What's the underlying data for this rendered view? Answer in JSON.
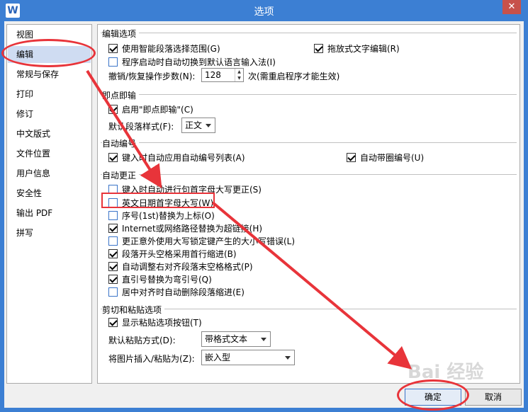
{
  "window": {
    "title": "选项",
    "close_glyph": "✕",
    "app_icon_letter": "W"
  },
  "nav": {
    "items": [
      {
        "label": "视图"
      },
      {
        "label": "编辑"
      },
      {
        "label": "常规与保存"
      },
      {
        "label": "打印"
      },
      {
        "label": "修订"
      },
      {
        "label": "中文版式"
      },
      {
        "label": "文件位置"
      },
      {
        "label": "用户信息"
      },
      {
        "label": "安全性"
      },
      {
        "label": "输出 PDF"
      },
      {
        "label": "拼写"
      }
    ],
    "selected": "编辑"
  },
  "sections": {
    "edit": {
      "title": "编辑选项",
      "smart_para": "使用智能段落选择范围(G)",
      "drag_drop": "拖放式文字编辑(R)",
      "auto_ime": "程序启动时自动切换到默认语言输入法(I)",
      "undo_label": "撤销/恢复操作步数(N):",
      "undo_value": "128",
      "undo_suffix": "次(需重启程序才能生效)"
    },
    "click_type": {
      "title": "即点即输",
      "enable": "启用\"即点即输\"(C)",
      "default_style_label": "默认段落样式(F):",
      "default_style_value": "正文"
    },
    "autonum": {
      "title": "自动编号",
      "auto_list": "键入时自动应用自动编号列表(A)",
      "auto_circle": "自动带圈编号(U)"
    },
    "autocorrect": {
      "title": "自动更正",
      "items": [
        {
          "label": "键入时自动进行句首字母大写更正(S)",
          "checked": false
        },
        {
          "label": "英文日期首字母大写(W)",
          "checked": false
        },
        {
          "label": "序号(1st)替换为上标(O)",
          "checked": false
        },
        {
          "label": "Internet或网络路径替换为超链接(H)",
          "checked": true
        },
        {
          "label": "更正意外使用大写锁定键产生的大小写错误(L)",
          "checked": false
        },
        {
          "label": "段落开头空格采用首行缩进(B)",
          "checked": true
        },
        {
          "label": "自动调整右对齐段落末空格格式(P)",
          "checked": true
        },
        {
          "label": "直引号替换为弯引号(Q)",
          "checked": true
        },
        {
          "label": "居中对齐时自动删除段落缩进(E)",
          "checked": false
        }
      ]
    },
    "paste": {
      "title": "剪切和粘贴选项",
      "show_btn": "显示粘贴选项按钮(T)",
      "default_paste_label": "默认粘贴方式(D):",
      "default_paste_value": "带格式文本",
      "image_insert_label": "将图片插入/粘贴为(Z):",
      "image_insert_value": "嵌入型"
    }
  },
  "buttons": {
    "ok": "确定",
    "cancel": "取消"
  },
  "watermark": "Bai 经验",
  "colors": {
    "titlebar": "#3c7fd3",
    "annotation": "#e8343a",
    "nav_selected": "#cfdcf2"
  }
}
